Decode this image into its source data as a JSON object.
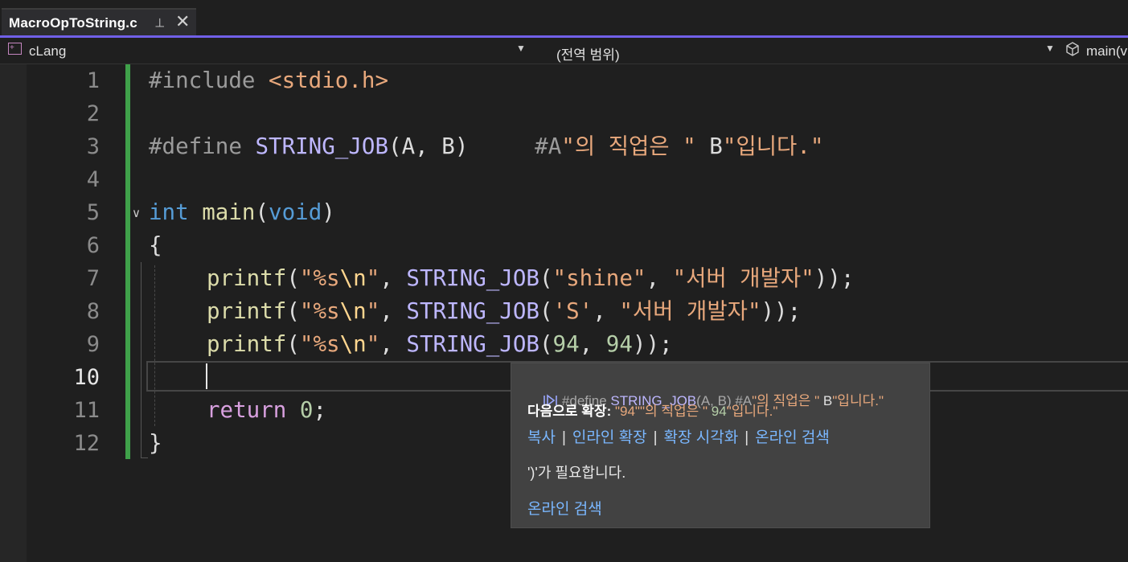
{
  "tab": {
    "title": "MacroOpToString.c",
    "pin_glyph": "⊣",
    "close_glyph": "✕"
  },
  "navbar": {
    "project": "cLang",
    "scope": "(전역 범위)",
    "member": "main(v"
  },
  "editor": {
    "current_line": 10,
    "line_numbers": [
      "1",
      "2",
      "3",
      "4",
      "5",
      "6",
      "7",
      "8",
      "9",
      "10",
      "11",
      "12"
    ],
    "lines": {
      "l1": {
        "pp": "#include ",
        "header": "<stdio.h>"
      },
      "l3": {
        "pp": "#define ",
        "macro": "STRING_JOB",
        "params": "(A, B)",
        "gap": "     ",
        "body_a": "#A",
        "body_str": "\"의 직업은 \"",
        "body_b": " B",
        "body_str2": "\"입니다.\""
      },
      "l5": {
        "kw": "int",
        "sp": " ",
        "fn": "main",
        "open": "(",
        "kw2": "void",
        "close": ")"
      },
      "l6": {
        "brace": "{"
      },
      "l7": {
        "fn": "printf",
        "p1": "(",
        "s1": "\"%s",
        "esc": "\\n",
        "s2": "\"",
        "c1": ", ",
        "macro": "STRING_JOB",
        "p2": "(",
        "a1": "\"shine\"",
        "c2": ", ",
        "a2": "\"서버 개발자\"",
        "end": "));"
      },
      "l8": {
        "fn": "printf",
        "p1": "(",
        "s1": "\"%s",
        "esc": "\\n",
        "s2": "\"",
        "c1": ", ",
        "macro": "STRING_JOB",
        "p2": "(",
        "a1": "'S'",
        "c2": ", ",
        "a2": "\"서버 개발자\"",
        "end": "));"
      },
      "l9": {
        "fn": "printf",
        "p1": "(",
        "s1": "\"%s",
        "esc": "\\n",
        "s2": "\"",
        "c1": ", ",
        "macro": "STRING_JOB",
        "p2": "(",
        "a1": "94",
        "c2": ", ",
        "a2": "94",
        "end": "));"
      },
      "l11": {
        "kw": "return",
        "sp": " ",
        "num": "0",
        "end": ";"
      },
      "l12": {
        "brace": "}"
      }
    }
  },
  "tooltip": {
    "def_prefix": "#define ",
    "def_macro": "STRING_JOB",
    "def_params": "(A, B) ",
    "def_body_a": "#A",
    "def_body_str": "\"의 직업은 \"",
    "def_body_b": " B",
    "def_body_str2": "\"입니다.\"",
    "expand_label": "다음으로 확장: ",
    "expand_a": "\"94\"",
    "expand_str": "\"의 직업은 \"",
    "expand_b": " 94",
    "expand_str2": "\"입니다.\"",
    "links": [
      "복사",
      "인라인 확장",
      "확장 시각화",
      "온라인 검색"
    ],
    "separator": "|",
    "error": "')'가 필요합니다.",
    "search": "온라인 검색"
  },
  "colors": {
    "accent": "#7160e8",
    "change_bar": "#3fa14a",
    "keyword": "#569cd6",
    "macro": "#beb7ff",
    "string": "#e8a87c",
    "link": "#7ab7ff"
  }
}
